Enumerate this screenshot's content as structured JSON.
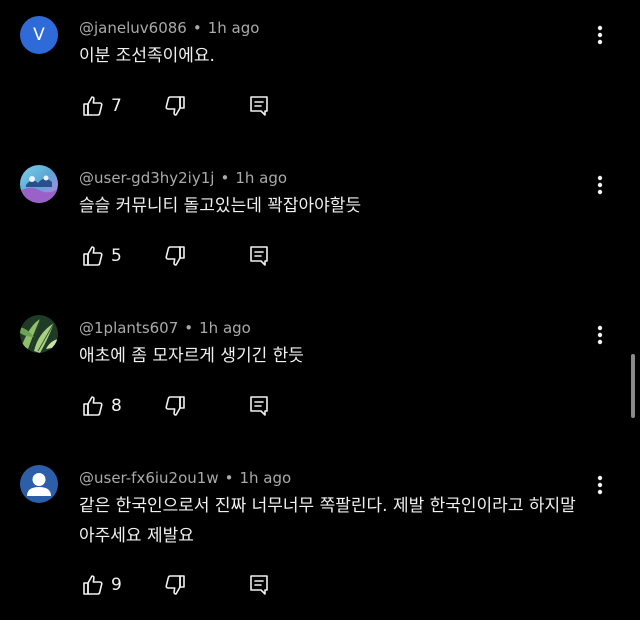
{
  "comments": [
    {
      "handle": "@janeluv6086",
      "time": "1h ago",
      "avatar_letter": "V",
      "avatar_color": "#2f6ad9",
      "text": "이분 조선족이에요.",
      "likes": "7"
    },
    {
      "handle": "@user-gd3hy2iy1j",
      "time": "1h ago",
      "text": "슬슬 커뮤니티 돌고있는데 꽉잡아야할듯",
      "likes": "5"
    },
    {
      "handle": "@1plants607",
      "time": "1h ago",
      "text": "애초에 좀 모자르게 생기긴 한듯",
      "likes": "8"
    },
    {
      "handle": "@user-fx6iu2ou1w",
      "time": "1h ago",
      "avatar_color": "#2c5fa8",
      "text": "같은 한국인으로서 진짜 너무너무 쪽팔린다. 제발 한국인이라고 하지말아주세요 제발요",
      "likes": "9"
    }
  ],
  "separator": "•",
  "icons": {
    "like": "thumbs-up-icon",
    "dislike": "thumbs-down-icon",
    "reply": "reply-comment-icon",
    "more": "more-vertical-icon",
    "default_avatar": "person-icon"
  },
  "colors": {
    "background": "#000000",
    "text": "#f1f1f1",
    "meta": "#aaaaaa"
  }
}
